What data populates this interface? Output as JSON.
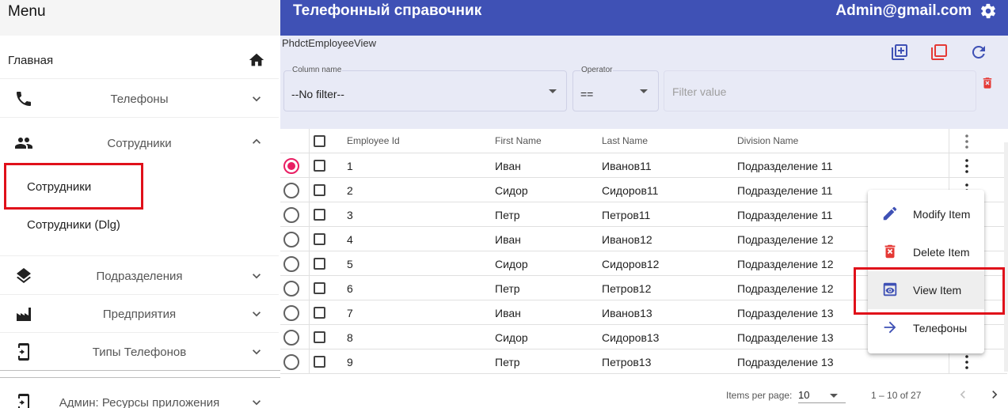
{
  "sidebar": {
    "title": "Menu",
    "home": {
      "label": "Главная",
      "icon": "home-icon"
    },
    "items": [
      {
        "label": "Телефоны",
        "icon": "phone-icon",
        "expanded": false
      },
      {
        "label": "Сотрудники",
        "icon": "people-icon",
        "expanded": true,
        "children": [
          {
            "label": "Сотрудники",
            "highlighted": true
          },
          {
            "label": "Сотрудники (Dlg)"
          }
        ]
      },
      {
        "label": "Подразделения",
        "icon": "layers-icon",
        "expanded": false
      },
      {
        "label": "Предприятия",
        "icon": "factory-icon",
        "expanded": false
      },
      {
        "label": "Типы Телефонов",
        "icon": "phone-settings-icon",
        "expanded": false
      },
      {
        "label": "Админ: Ресурсы приложения",
        "icon": "phone-settings-icon",
        "expanded": false
      }
    ]
  },
  "header": {
    "title": "Телефонный справочник",
    "user": "Admin@gmail.com",
    "settings_icon": "gear-icon",
    "color": "#3f51b5"
  },
  "filter": {
    "view_name": "PhdctEmployeeView",
    "column": {
      "label": "Column name",
      "value": "--No filter--"
    },
    "operator": {
      "label": "Operator",
      "value": "=="
    },
    "value": {
      "placeholder": "Filter value"
    }
  },
  "table": {
    "headers": {
      "employee_id": "Employee Id",
      "first_name": "First Name",
      "last_name": "Last Name",
      "division": "Division Name"
    },
    "rows": [
      {
        "id": "1",
        "first": "Иван",
        "last": "Иванов11",
        "division": "Подразделение 11",
        "selected": true
      },
      {
        "id": "2",
        "first": "Сидор",
        "last": "Сидоров11",
        "division": "Подразделение 11"
      },
      {
        "id": "3",
        "first": "Петр",
        "last": "Петров11",
        "division": "Подразделение 11"
      },
      {
        "id": "4",
        "first": "Иван",
        "last": "Иванов12",
        "division": "Подразделение 12"
      },
      {
        "id": "5",
        "first": "Сидор",
        "last": "Сидоров12",
        "division": "Подразделение 12"
      },
      {
        "id": "6",
        "first": "Петр",
        "last": "Петров12",
        "division": "Подразделение 12"
      },
      {
        "id": "7",
        "first": "Иван",
        "last": "Иванов13",
        "division": "Подразделение 13"
      },
      {
        "id": "8",
        "first": "Сидор",
        "last": "Сидоров13",
        "division": "Подразделение 13"
      },
      {
        "id": "9",
        "first": "Петр",
        "last": "Петров13",
        "division": "Подразделение 13"
      }
    ]
  },
  "context_menu": {
    "items": [
      {
        "label": "Modify Item",
        "icon": "edit-icon"
      },
      {
        "label": "Delete Item",
        "icon": "delete-icon"
      },
      {
        "label": "View Item",
        "icon": "view-icon",
        "highlighted": true
      },
      {
        "label": "Телефоны",
        "icon": "arrow-right-icon"
      }
    ]
  },
  "paginator": {
    "items_per_page_label": "Items per page:",
    "page_size": "10",
    "range": "1 – 10 of 27"
  },
  "colors": {
    "primary": "#3f51b5",
    "accent": "#e91e63",
    "warn": "#e53935",
    "highlight_box": "#e0101a"
  }
}
